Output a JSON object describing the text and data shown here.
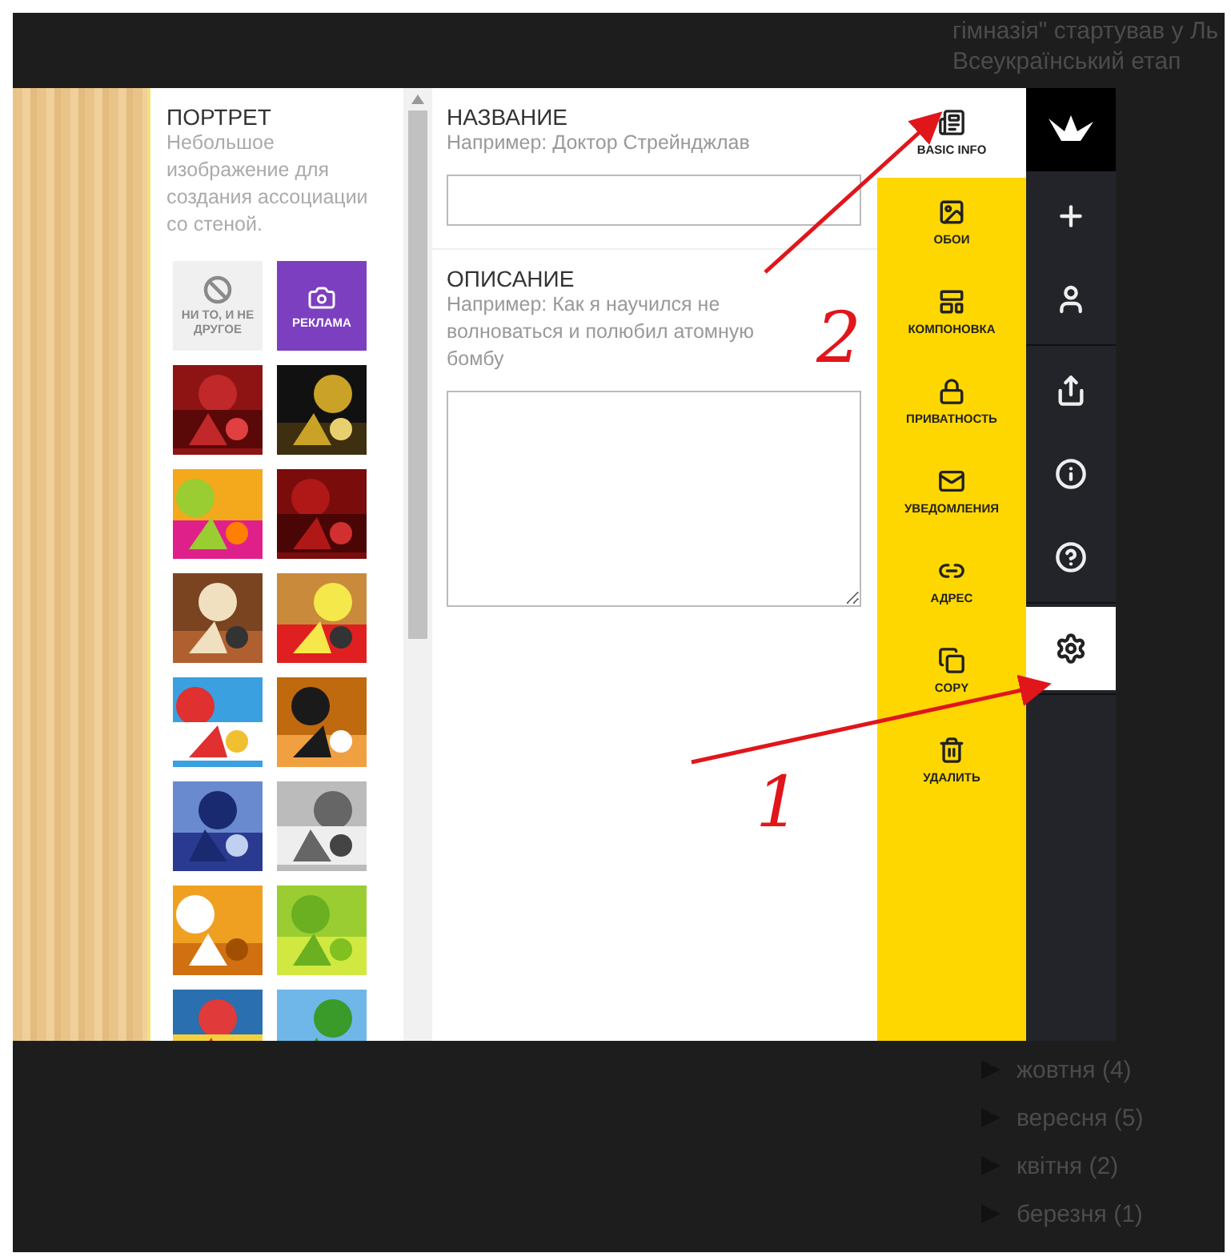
{
  "background": {
    "top_lines": [
      "гімназія\" стартував у Ль",
      "Всеукраїнський етап"
    ],
    "archive": [
      "жовтня (4)",
      "вересня (5)",
      "квітня (2)",
      "березня (1)"
    ]
  },
  "portrait": {
    "title": "ПОРТРЕТ",
    "hint": "Небольшое изображение для создания ассоциации со стеной.",
    "tiles": [
      {
        "kind": "none",
        "label": "НИ ТО, И НЕ ДРУГОЕ",
        "selected": false
      },
      {
        "kind": "ad",
        "label": "РЕКЛАМА",
        "selected": false
      },
      {
        "kind": "picture"
      },
      {
        "kind": "picture"
      },
      {
        "kind": "picture"
      },
      {
        "kind": "picture"
      },
      {
        "kind": "picture"
      },
      {
        "kind": "picture"
      },
      {
        "kind": "picture"
      },
      {
        "kind": "picture"
      },
      {
        "kind": "picture"
      },
      {
        "kind": "picture"
      },
      {
        "kind": "picture"
      },
      {
        "kind": "picture"
      },
      {
        "kind": "picture"
      },
      {
        "kind": "picture"
      }
    ]
  },
  "form": {
    "fields": [
      {
        "kind": "input",
        "label": "НАЗВАНИЕ",
        "hint": "Например: Доктор Стрейнджлав"
      },
      {
        "kind": "textarea",
        "label": "ОПИСАНИЕ",
        "hint": "Например: Как я научился не волноваться и полюбил атомную бомбу"
      }
    ]
  },
  "menu": [
    {
      "kind": "info",
      "label": "BASIC INFO",
      "selected": true
    },
    {
      "kind": "wallpaper",
      "label": "ОБОИ",
      "selected": false
    },
    {
      "kind": "layout",
      "label": "КОМПОНОВКА",
      "selected": false
    },
    {
      "kind": "privacy",
      "label": "ПРИВАТНОСТЬ",
      "selected": false
    },
    {
      "kind": "notify",
      "label": "УВЕДОМЛЕНИЯ",
      "selected": false
    },
    {
      "kind": "address",
      "label": "АДРЕС",
      "selected": false
    },
    {
      "kind": "copy",
      "label": "COPY",
      "selected": false
    },
    {
      "kind": "delete",
      "label": "УДАЛИТЬ",
      "selected": false
    }
  ],
  "rail": [
    [
      {
        "kind": "add",
        "selected": false
      },
      {
        "kind": "user",
        "selected": false
      }
    ],
    [
      {
        "kind": "share",
        "selected": false
      },
      {
        "kind": "info",
        "selected": false
      },
      {
        "kind": "help",
        "selected": false
      }
    ],
    [
      {
        "kind": "settings",
        "selected": true
      }
    ]
  ],
  "annotations": [
    {
      "label": "2"
    },
    {
      "label": "1"
    }
  ]
}
